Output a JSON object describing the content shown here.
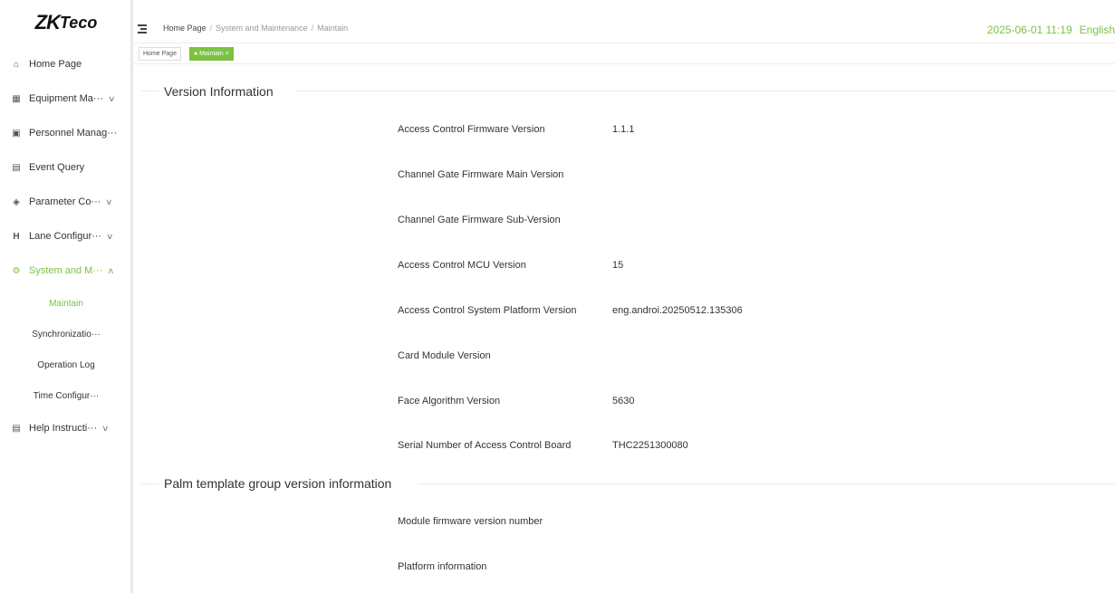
{
  "logo": {
    "zk": "ZK",
    "teco": "Teco"
  },
  "sidebar": {
    "items": [
      {
        "label": "Home Page",
        "icon": "home-icon",
        "has_chevron": false
      },
      {
        "label": "Equipment Ma···",
        "icon": "device-icon",
        "has_chevron": true
      },
      {
        "label": "Personnel Manag···",
        "icon": "person-icon",
        "has_chevron": false
      },
      {
        "label": "Event Query",
        "icon": "clipboard-icon",
        "has_chevron": false
      },
      {
        "label": "Parameter Co···",
        "icon": "parameter-icon",
        "has_chevron": true
      },
      {
        "label": "Lane Configur···",
        "icon": "lane-icon",
        "has_chevron": true
      },
      {
        "label": "System and M···",
        "icon": "gear-icon",
        "has_chevron": true
      }
    ],
    "subitems": [
      {
        "label": "Maintain"
      },
      {
        "label": "Synchronizatio···"
      },
      {
        "label": "Operation Log"
      },
      {
        "label": "Time Configur···"
      }
    ],
    "help": {
      "label": "Help Instructi···",
      "icon": "help-icon"
    }
  },
  "header": {
    "breadcrumb": [
      "Home Page",
      "System and Maintenance",
      "Maintain"
    ],
    "datetime": "2025-06-01 11:19",
    "language": "English"
  },
  "tabs": [
    {
      "label": "Home Page"
    },
    {
      "label": "● Maintain ×"
    }
  ],
  "version_info": {
    "title": "Version Information",
    "rows": [
      {
        "label": "Access Control Firmware Version",
        "value": "1.1.1"
      },
      {
        "label": "Channel Gate Firmware Main Version",
        "value": ""
      },
      {
        "label": "Channel Gate Firmware Sub-Version",
        "value": ""
      },
      {
        "label": "Access Control MCU Version",
        "value": "15"
      },
      {
        "label": "Access Control System Platform Version",
        "value": "eng.androi.20250512.135306"
      },
      {
        "label": "Card Module Version",
        "value": ""
      },
      {
        "label": "Face Algorithm Version",
        "value": "5630"
      },
      {
        "label": "Serial Number of Access Control Board",
        "value": "THC2251300080"
      }
    ]
  },
  "palm_info": {
    "title": "Palm template group version information",
    "rows": [
      {
        "label": "Module firmware version number",
        "value": ""
      },
      {
        "label": "Platform information",
        "value": ""
      }
    ]
  },
  "colors": {
    "accent": "#7cc242"
  }
}
